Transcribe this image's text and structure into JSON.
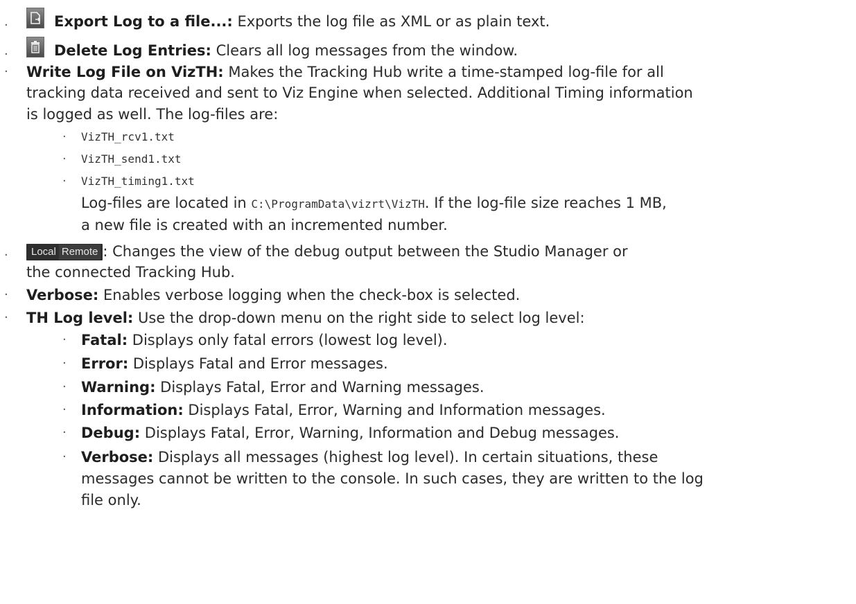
{
  "items": [
    {
      "term": "Export Log to a file...:",
      "desc": " Exports the log file as XML or as plain text.",
      "icon": "export-icon"
    },
    {
      "term": "Delete Log Entries:",
      "desc": " Clears all log messages from the window.",
      "icon": "trash-icon"
    },
    {
      "term": "Write Log File on VizTH:",
      "desc_line1": " Makes the Tracking Hub write a time-stamped log-file for all",
      "desc_line2": "tracking data received and sent to Viz Engine when selected. Additional Timing information",
      "desc_line3": "is logged as well. The log-files are:"
    },
    {
      "tabs": [
        "Local",
        "Remote"
      ],
      "desc_line1": ": Changes the view of the debug output between the Studio Manager or",
      "desc_line2": "the connected Tracking Hub."
    },
    {
      "term": "Verbose:",
      "desc": " Enables verbose logging when the check-box is selected."
    },
    {
      "term": "TH Log level:",
      "desc": " Use the drop-down menu on the right side to select log level:"
    }
  ],
  "logfiles": [
    "VizTH_rcv1.txt",
    "VizTH_send1.txt",
    "VizTH_timing1.txt"
  ],
  "logfiles_note": {
    "pre": "Log-files are located in ",
    "path": "C:\\ProgramData\\vizrt\\VizTH",
    "post": ". If the log-file size reaches 1 MB,",
    "line2": "a new file is created with an incremented number."
  },
  "levels": [
    {
      "term": "Fatal:",
      "desc": " Displays only fatal errors (lowest log level)."
    },
    {
      "term": "Error:",
      "desc": " Displays Fatal and Error messages."
    },
    {
      "term": "Warning:",
      "desc": " Displays Fatal, Error and Warning messages."
    },
    {
      "term": "Information:",
      "desc": " Displays Fatal, Error, Warning and Information messages."
    },
    {
      "term": "Debug:",
      "desc": " Displays Fatal, Error, Warning, Information and Debug messages."
    },
    {
      "term": "Verbose:",
      "desc_line1": " Displays all messages (highest log level). In certain situations, these",
      "desc_line2": "messages cannot be written to the console. In such cases, they are written to the log",
      "desc_line3": "file only."
    }
  ]
}
